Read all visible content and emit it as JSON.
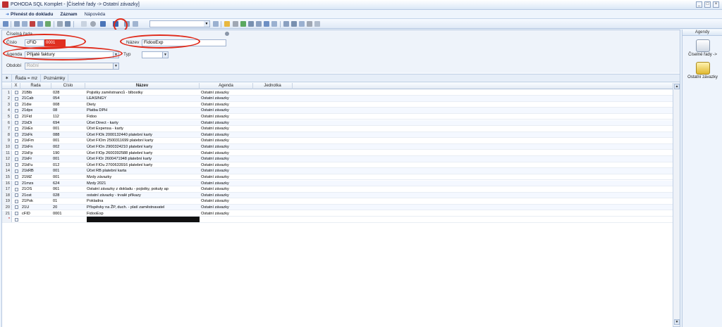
{
  "window": {
    "title": "POHODA SQL Komplet - [Číselné řady -> Ostatní závazky]",
    "controls": [
      "_",
      "□",
      "×"
    ]
  },
  "menu": {
    "items": [
      {
        "label": "Přenést do dokladu",
        "bold": true
      },
      {
        "label": "Záznam",
        "bold": true
      },
      {
        "label": "Nápověda",
        "bold": false
      }
    ]
  },
  "form": {
    "section_title": "Číselná řada",
    "cislo_label": "Číslo",
    "cislo_value": "cFID",
    "cislo_highlight": "0001",
    "nazev_label": "Název",
    "nazev_value": "FidooExp",
    "agenda_label": "Agenda",
    "agenda_value": "Přijaté faktury",
    "typ_label": "Typ",
    "typ_value": "",
    "obdobi_label": "Období",
    "obdobi_value": "Roční"
  },
  "filterbar": {
    "items": [
      "✶",
      "Řada = mz",
      "Poznámky"
    ]
  },
  "grid": {
    "columns": [
      "",
      "X",
      "Řada",
      "Číslo",
      "Název",
      "Agenda",
      "Jednotka"
    ],
    "rows": [
      {
        "n": "1",
        "rada": "21Blb",
        "cislo": "028",
        "nazev": "Pojistky zaměstnanců - blbostky",
        "agenda": "Ostatní závazky"
      },
      {
        "n": "2",
        "rada": "21Cab",
        "cislo": "054",
        "nazev": "LEASINGY",
        "agenda": "Ostatní závazky"
      },
      {
        "n": "3",
        "rada": "21die",
        "cislo": "008",
        "nazev": "Diety",
        "agenda": "Ostatní závazky"
      },
      {
        "n": "4",
        "rada": "21dpx",
        "cislo": "08",
        "nazev": "Platba DPH",
        "agenda": "Ostatní závazky"
      },
      {
        "n": "5",
        "rada": "21Fid",
        "cislo": "112",
        "nazev": "Fidoo",
        "agenda": "Ostatní závazky"
      },
      {
        "n": "6",
        "rada": "21kDi",
        "cislo": "694",
        "nazev": "Účet Direct - karty",
        "agenda": "Ostatní závazky"
      },
      {
        "n": "7",
        "rada": "21kEx",
        "cislo": "001",
        "nazev": "Účet Expensa - karty",
        "agenda": "Ostatní závazky"
      },
      {
        "n": "8",
        "rada": "21kFk",
        "cislo": "088",
        "nazev": "Účet FIOk 2000132440 platební karty",
        "agenda": "Ostatní závazky"
      },
      {
        "n": "9",
        "rada": "21kFm",
        "cislo": "001",
        "nazev": "Účet FIOm 2500311699 platební karty",
        "agenda": "Ostatní závazky"
      },
      {
        "n": "10",
        "rada": "21kFn",
        "cislo": "002",
        "nazev": "Účet FIOn 2900324210 platební karty",
        "agenda": "Ostatní závazky"
      },
      {
        "n": "11",
        "rada": "21kFp",
        "cislo": "190",
        "nazev": "Účet FIOp 2600392588 platební karty",
        "agenda": "Ostatní závazky"
      },
      {
        "n": "12",
        "rada": "21kFr",
        "cislo": "001",
        "nazev": "Účet FIOr 2600471948 platební karty",
        "agenda": "Ostatní závazky"
      },
      {
        "n": "13",
        "rada": "21kFu",
        "cislo": "012",
        "nazev": "Účet FIOu 2700633916 platební karty",
        "agenda": "Ostatní závazky"
      },
      {
        "n": "14",
        "rada": "21kRB",
        "cislo": "001",
        "nazev": "Účet RB platební karta",
        "agenda": "Ostatní závazky"
      },
      {
        "n": "15",
        "rada": "21MZ",
        "cislo": "001",
        "nazev": "Mzdy závazky",
        "agenda": "Ostatní závazky"
      },
      {
        "n": "16",
        "rada": "21mzs",
        "cislo": "624",
        "nazev": "Mzdy 2021",
        "agenda": "Ostatní závazky"
      },
      {
        "n": "17",
        "rada": "21OS",
        "cislo": "061",
        "nazev": "Ostatní závazky z dokladu - pojistky, pokuty ap",
        "agenda": "Ostatní závazky"
      },
      {
        "n": "18",
        "rada": "21ost",
        "cislo": "028",
        "nazev": "ostatní závazky - trvalé příkazy",
        "agenda": "Ostatní závazky"
      },
      {
        "n": "19",
        "rada": "21Pok",
        "cislo": "01",
        "nazev": "Pokladna",
        "agenda": "Ostatní závazky"
      },
      {
        "n": "20",
        "rada": "21U",
        "cislo": "20",
        "nazev": "Příspěvky na ŽP, duch. - platí zaměstnavatel",
        "agenda": "Ostatní závazky"
      },
      {
        "n": "21",
        "rada": "cFID",
        "cislo": "0001",
        "nazev": "FidooExp",
        "agenda": "Ostatní závazky"
      }
    ],
    "new_row_marker": "*"
  },
  "right_panel": {
    "title": "Agendy",
    "items": [
      {
        "label": "Číselné řady ->",
        "icon": "calculator-icon"
      },
      {
        "label": "Ostatní závazky",
        "icon": "folder-icon"
      }
    ]
  },
  "colors": {
    "highlight_red": "#e03020",
    "annotation_red": "#e02a1a",
    "accent_blue": "#2a66c8"
  }
}
